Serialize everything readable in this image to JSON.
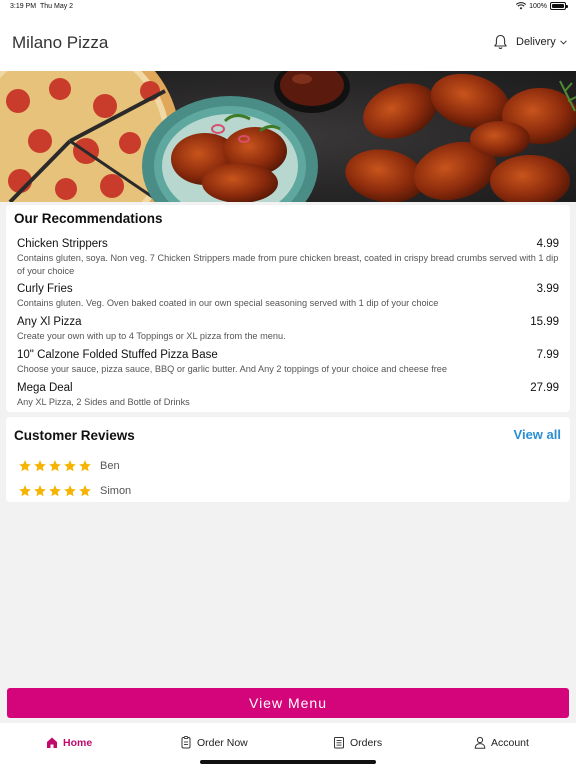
{
  "status_bar": {
    "time": "3:19 PM",
    "date": "Thu May 2",
    "battery": "100%"
  },
  "header": {
    "title": "Milano Pizza",
    "delivery_label": "Delivery"
  },
  "recommendations": {
    "title": "Our Recommendations",
    "items": [
      {
        "name": "Chicken Strippers",
        "price": "4.99",
        "desc": "Contains gluten, soya. Non veg. 7 Chicken Strippers made from pure chicken breast, coated in crispy bread crumbs served with 1 dip of your choice"
      },
      {
        "name": "Curly Fries",
        "price": "3.99",
        "desc": "Contains gluten. Veg. Oven baked coated in our own special seasoning served with 1 dip of your choice"
      },
      {
        "name": "Any Xl Pizza",
        "price": "15.99",
        "desc": "Create your own with up to 4 Toppings or XL pizza from the menu."
      },
      {
        "name": "10\" Calzone Folded Stuffed Pizza Base",
        "price": "7.99",
        "desc": "Choose your sauce, pizza sauce, BBQ or garlic butter. And Any 2 toppings of your choice and cheese free"
      },
      {
        "name": "Mega Deal",
        "price": "27.99",
        "desc": "Any XL Pizza, 2 Sides and Bottle of Drinks"
      }
    ]
  },
  "reviews": {
    "title": "Customer Reviews",
    "view_all": "View all",
    "items": [
      {
        "name": "Ben",
        "stars": 5
      },
      {
        "name": "Simon",
        "stars": 5
      }
    ]
  },
  "view_menu_label": "View Menu",
  "tabs": [
    {
      "label": "Home",
      "icon": "home-icon"
    },
    {
      "label": "Order Now",
      "icon": "order-icon"
    },
    {
      "label": "Orders",
      "icon": "receipt-icon"
    },
    {
      "label": "Account",
      "icon": "person-icon"
    }
  ],
  "colors": {
    "brand": "#d4057a",
    "active_tab": "#c2096c",
    "link": "#2a8ed2",
    "star": "#f5b400"
  }
}
